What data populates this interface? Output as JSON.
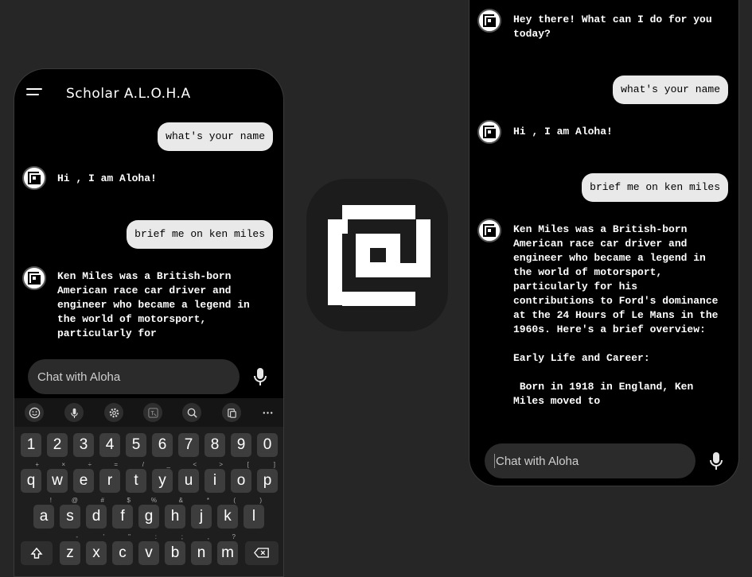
{
  "left_phone": {
    "app_title": "Scholar A.L.O.H.A",
    "messages": [
      {
        "role": "user",
        "text": "what's your name"
      },
      {
        "role": "bot",
        "text": "Hi , I am Aloha!"
      },
      {
        "role": "user",
        "text": "brief me on ken miles"
      },
      {
        "role": "bot",
        "text": "Ken Miles was a British-born\nAmerican race car driver and\nengineer who became a legend in\nthe world of motorsport,\nparticularly for"
      }
    ],
    "input_placeholder": "Chat with Aloha"
  },
  "keyboard": {
    "toolbar_icons": [
      "emoji-icon",
      "mic-icon",
      "settings-icon",
      "translate-icon",
      "search-icon",
      "clipboard-icon",
      "more-icon"
    ],
    "row_numbers": [
      "1",
      "2",
      "3",
      "4",
      "5",
      "6",
      "7",
      "8",
      "9",
      "0"
    ],
    "row_q": [
      {
        "k": "q",
        "s": "+"
      },
      {
        "k": "w",
        "s": "×"
      },
      {
        "k": "e",
        "s": "÷"
      },
      {
        "k": "r",
        "s": "="
      },
      {
        "k": "t",
        "s": "/"
      },
      {
        "k": "y",
        "s": "_"
      },
      {
        "k": "u",
        "s": "<"
      },
      {
        "k": "i",
        "s": ">"
      },
      {
        "k": "o",
        "s": "["
      },
      {
        "k": "p",
        "s": "]"
      }
    ],
    "row_a": [
      {
        "k": "a",
        "s": "!"
      },
      {
        "k": "s",
        "s": "@"
      },
      {
        "k": "d",
        "s": "#"
      },
      {
        "k": "f",
        "s": "$"
      },
      {
        "k": "g",
        "s": "%"
      },
      {
        "k": "h",
        "s": "&"
      },
      {
        "k": "j",
        "s": "*"
      },
      {
        "k": "k",
        "s": "("
      },
      {
        "k": "l",
        "s": ")"
      }
    ],
    "row_z": [
      {
        "k": "z",
        "s": "-"
      },
      {
        "k": "x",
        "s": "'"
      },
      {
        "k": "c",
        "s": "\""
      },
      {
        "k": "v",
        "s": ":"
      },
      {
        "k": "b",
        "s": ";"
      },
      {
        "k": "n",
        "s": ","
      },
      {
        "k": "m",
        "s": "?"
      }
    ]
  },
  "right_phone": {
    "messages": [
      {
        "role": "bot",
        "text": "Hey there! What can I do for you\ntoday?"
      },
      {
        "role": "user",
        "text": "what's your name"
      },
      {
        "role": "bot",
        "text": "Hi , I am Aloha!"
      },
      {
        "role": "user",
        "text": "brief me on ken miles"
      },
      {
        "role": "bot",
        "text": "Ken Miles was a British-born\nAmerican race car driver and\nengineer who became a legend in\nthe world of motorsport,\nparticularly for his\ncontributions to Ford's dominance\nat the 24 Hours of Le Mans in the\n1960s. Here's a brief overview:\n\nEarly Life and Career:\n\n Born in 1918 in England, Ken\nMiles moved to"
      }
    ],
    "input_placeholder": "Chat with Aloha"
  },
  "colors": {
    "background": "#262626",
    "screen": "#000000",
    "user_bubble": "#e9e9e9",
    "key": "#3d3d3d",
    "cursor_accent": "#6b8cff"
  }
}
